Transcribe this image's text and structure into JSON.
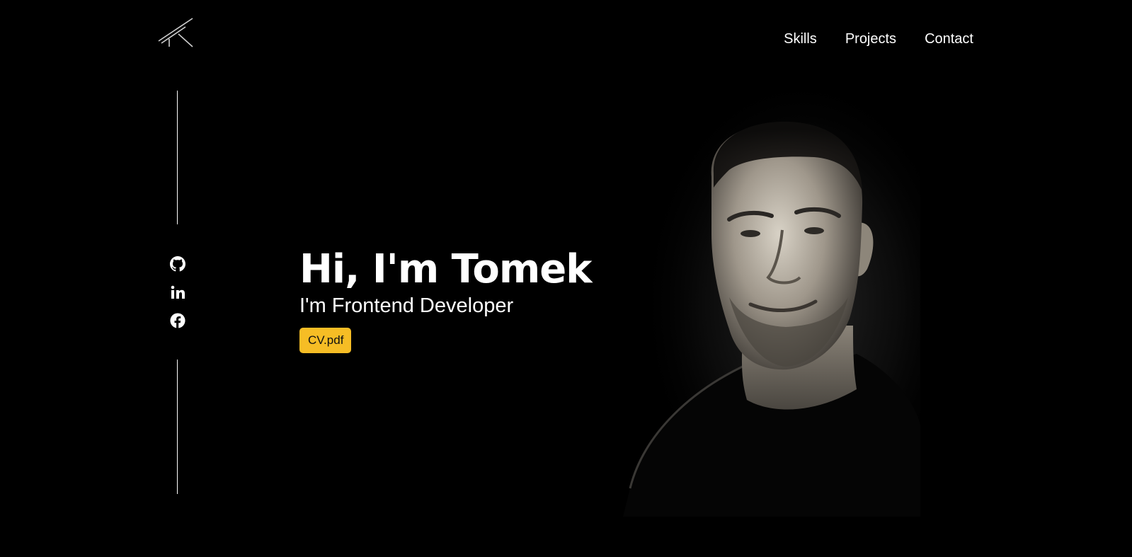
{
  "header": {
    "logo_icon": "tk-monogram-logo",
    "nav": [
      {
        "label": "Skills"
      },
      {
        "label": "Projects"
      },
      {
        "label": "Contact"
      }
    ]
  },
  "social": [
    {
      "icon": "github-icon"
    },
    {
      "icon": "linkedin-icon"
    },
    {
      "icon": "facebook-icon"
    }
  ],
  "hero": {
    "title": "Hi, I'm Tomek",
    "subtitle": "I'm Frontend Developer",
    "cv_label": "CV.pdf"
  },
  "colors": {
    "background": "#000000",
    "text": "#ffffff",
    "accent": "#f6bd25"
  },
  "portrait": {
    "icon": "profile-portrait-image"
  }
}
